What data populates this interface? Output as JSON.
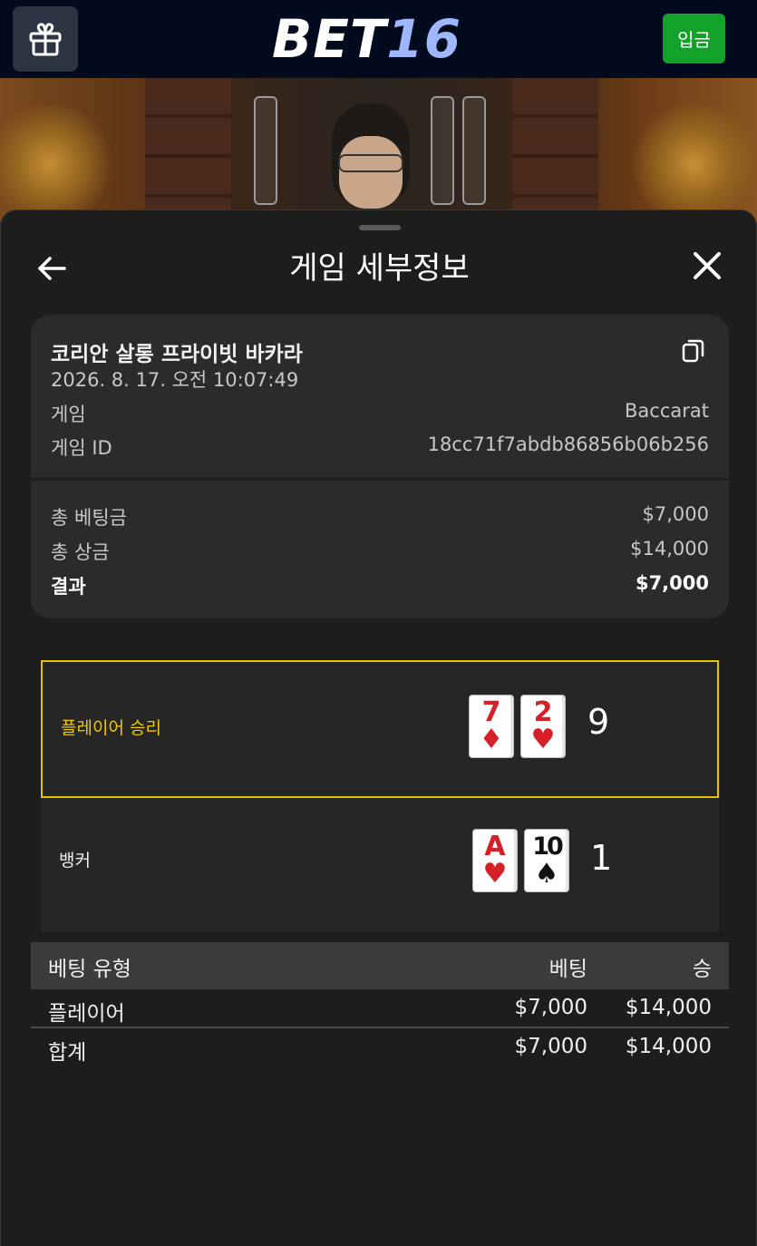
{
  "header": {
    "logo_main": "BET",
    "logo_num": "16",
    "deposit_label": "입금"
  },
  "sheet": {
    "title": "게임 세부정보"
  },
  "game": {
    "name": "코리안 살롱 프라이빗 바카라",
    "datetime": "2026. 8. 17. 오전 10:07:49",
    "game_label": "게임",
    "game_value": "Baccarat",
    "id_label": "게임 ID",
    "id_value": "18cc71f7abdb86856b06b256"
  },
  "summary": {
    "total_bet_label": "총 베팅금",
    "total_bet_value": "$7,000",
    "total_prize_label": "총 상금",
    "total_prize_value": "$14,000",
    "result_label": "결과",
    "result_value": "$7,000"
  },
  "hands": {
    "player": {
      "label": "플레이어 승리",
      "cards": [
        {
          "rank": "7",
          "suit": "♦",
          "color": "#d61f26"
        },
        {
          "rank": "2",
          "suit": "♥",
          "color": "#d61f26"
        }
      ],
      "score": "9"
    },
    "banker": {
      "label": "뱅커",
      "cards": [
        {
          "rank": "A",
          "suit": "♥",
          "color": "#d61f26"
        },
        {
          "rank": "10",
          "suit": "♠",
          "color": "#111111"
        }
      ],
      "score": "1"
    }
  },
  "bets": {
    "headers": {
      "type": "베팅 유형",
      "bet": "베팅",
      "win": "승"
    },
    "rows": [
      {
        "type": "플레이어",
        "bet": "$7,000",
        "win": "$14,000"
      }
    ],
    "total": {
      "type": "합계",
      "bet": "$7,000",
      "win": "$14,000"
    }
  },
  "colors": {
    "accent_yellow": "#e6c200",
    "deposit_green": "#12a22a",
    "header_bg": "#020b1e",
    "logo_blue": "#9fb7ff"
  },
  "icons": {
    "gift": "gift-icon",
    "back": "arrow-left-icon",
    "close": "close-icon",
    "copy": "copy-icon"
  }
}
